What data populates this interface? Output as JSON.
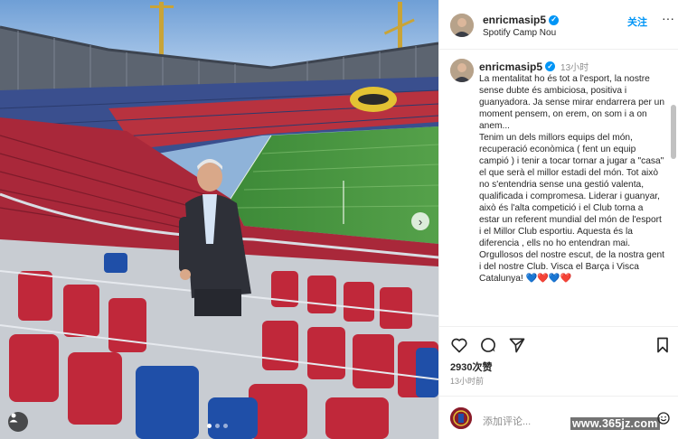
{
  "post": {
    "username": "enricmasip5",
    "location": "Spotify Camp Nou",
    "follow_label": "关注",
    "more_label": "···",
    "time_ago": "13小时",
    "caption": "La mentalitat ho és tot a l'esport, la nostre sense dubte és ambiciosa, positiva i guanyadora. Ja sense mirar endarrera per un moment pensem, on erem, on som i a on anem...\nTenim un dels millors equips del món, recuperació econòmica ( fent un equip campió ) i tenir a tocar tornar a jugar a \"casa\" el que serà el millor estadi del món. Tot això no s'entendria sense una gestió valenta, qualificada i compromesa. Liderar i guanyar, això és l'alta competició i el Club torna a estar un referent mundial del món de l'esport i el Millor Club esportiu. Aquesta és la diferencia , ells no ho entendran mai. Orgullosos del nostre escut, de la nostra gent i del nostre Club. Visca el Barça i Visca Catalunya! 💙❤️💙❤️",
    "likes": "2930次赞",
    "posted": "13小时前"
  },
  "comment": {
    "placeholder": "添加评论..."
  },
  "watermark": "www.365jz.com",
  "icons": {
    "verified": "verified-badge-icon",
    "like": "heart-icon",
    "comment": "comment-icon",
    "share": "share-icon",
    "save": "bookmark-icon",
    "emoji": "emoji-icon",
    "tag": "user-tag-icon",
    "next": "chevron-right-icon"
  },
  "carousel": {
    "slides": 3,
    "active": 1
  },
  "colors": {
    "link_blue": "#0095f6",
    "verified_blue": "#0095f6",
    "seat_red": "#c0283a",
    "seat_blue": "#1f4fa8",
    "pitch_green": "#3f8a3a"
  }
}
